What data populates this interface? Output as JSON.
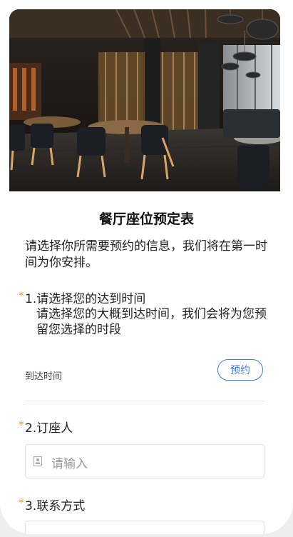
{
  "hero": {
    "image_name": "restaurant-interior"
  },
  "form": {
    "title": "餐厅座位预定表",
    "description": "请选择你所需要预约的信息，我们将在第一时间为你安排。",
    "required_mark": "*"
  },
  "q1": {
    "label": "1.请选择您的达到时间",
    "subtitle": "请选择您的大概到达时间，我们会将为您预留您选择的时段",
    "field_label": "到达时间",
    "button_label": "预约"
  },
  "q2": {
    "label": "2.订座人",
    "placeholder": "请输入",
    "icon": "contact-card-icon"
  },
  "q3": {
    "label": "3.联系方式"
  },
  "colors": {
    "accent": "#3c7be0",
    "required": "#f39c26"
  }
}
